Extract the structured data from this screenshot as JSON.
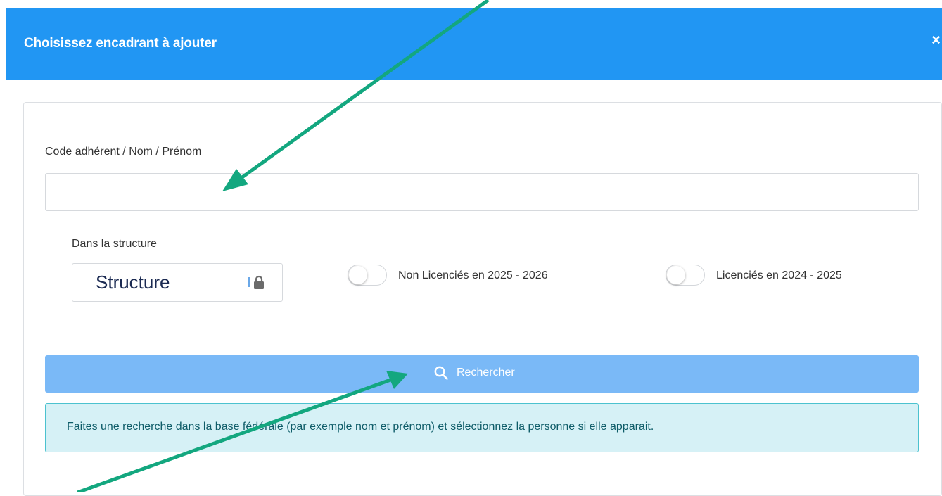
{
  "modal": {
    "title": "Choisissez encadrant à ajouter",
    "close_icon": "×"
  },
  "search": {
    "label": "Code adhérent / Nom / Prénom",
    "value": "",
    "placeholder": ""
  },
  "structure": {
    "label": "Dans la structure",
    "value": "Structure",
    "icon": "lock-icon",
    "locked": true
  },
  "toggles": [
    {
      "label": "Non Licenciés en 2025 - 2026",
      "checked": false
    },
    {
      "label": "Licenciés en 2024 - 2025",
      "checked": false
    }
  ],
  "search_button": {
    "label": "Rechercher",
    "icon": "search-icon"
  },
  "info": {
    "text": "Faites une recherche dans la base fédérale (par exemple nom et prénom) et sélectionnez la personne si elle apparait."
  },
  "annotations": {
    "arrow_color": "#13a77f",
    "count": 3
  },
  "colors": {
    "header": "#2196f3",
    "button": "#7ab9f7",
    "info_bg": "#d6f1f6",
    "info_border": "#4cc2cf"
  }
}
